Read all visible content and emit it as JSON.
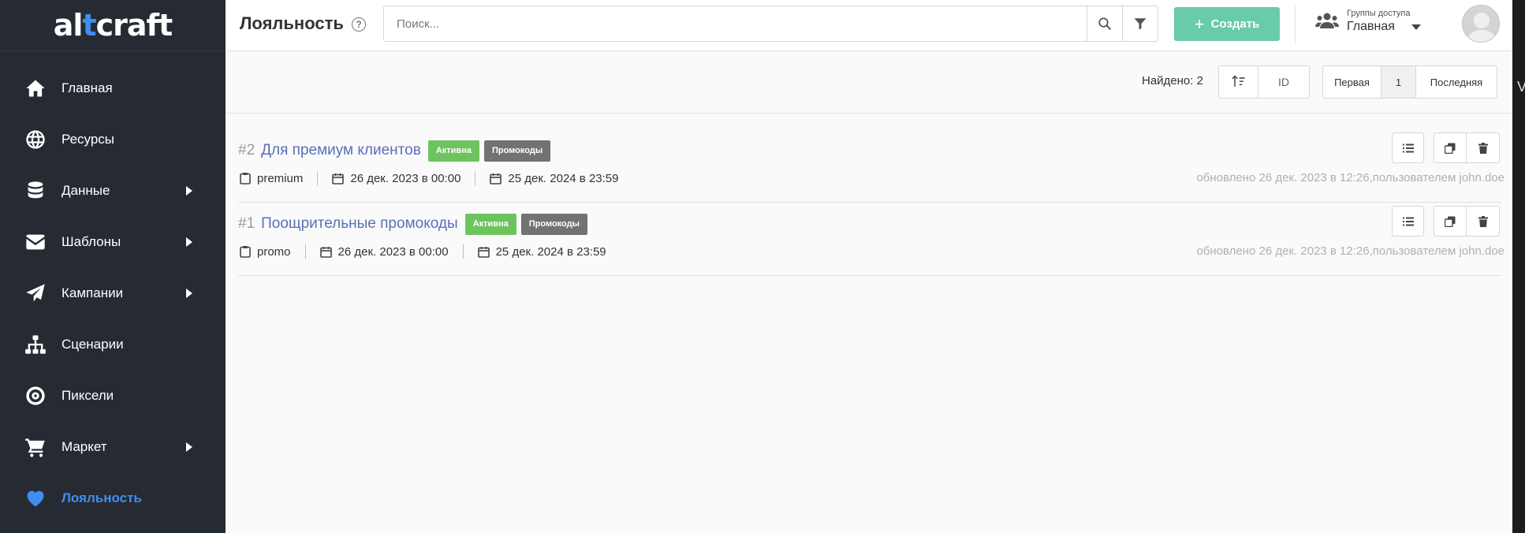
{
  "sidebar": {
    "logo": {
      "part1": "al",
      "part2": "t",
      "part3": "craft"
    },
    "items": [
      {
        "label": "Главная",
        "icon": "home-icon",
        "has_submenu": false
      },
      {
        "label": "Ресурсы",
        "icon": "globe-icon",
        "has_submenu": false
      },
      {
        "label": "Данные",
        "icon": "database-icon",
        "has_submenu": true
      },
      {
        "label": "Шаблоны",
        "icon": "envelope-icon",
        "has_submenu": true
      },
      {
        "label": "Кампании",
        "icon": "paper-plane-icon",
        "has_submenu": true
      },
      {
        "label": "Сценарии",
        "icon": "sitemap-icon",
        "has_submenu": false
      },
      {
        "label": "Пиксели",
        "icon": "target-icon",
        "has_submenu": false
      },
      {
        "label": "Маркет",
        "icon": "cart-icon",
        "has_submenu": true
      },
      {
        "label": "Лояльность",
        "icon": "heart-icon",
        "has_submenu": false,
        "active": true
      }
    ]
  },
  "header": {
    "title": "Лояльность",
    "help": "?",
    "search_placeholder": "Поиск...",
    "create_label": "Создать",
    "access_label": "Группы доступа",
    "access_value": "Главная"
  },
  "toolbar": {
    "found": "Найдено: 2",
    "sort_field": "ID",
    "pager": {
      "first": "Первая",
      "current": "1",
      "last": "Последняя"
    }
  },
  "rows": [
    {
      "id": "#2",
      "name": "Для премиум клиентов",
      "status": "Активна",
      "type": "Промокоды",
      "code": "premium",
      "start": "26 дек. 2023 в 00:00",
      "end": "25 дек. 2024 в 23:59",
      "updated": "обновлено 26 дек. 2023 в 12:26,пользователем john.doe"
    },
    {
      "id": "#1",
      "name": "Поощрительные промокоды",
      "status": "Активна",
      "type": "Промокоды",
      "code": "promo",
      "start": "26 дек. 2023 в 00:00",
      "end": "25 дек. 2024 в 23:59",
      "updated": "обновлено 26 дек. 2023 в 12:26,пользователем john.doe"
    }
  ],
  "edge_char": "V",
  "colors": {
    "sidebar_bg": "#262b33",
    "accent": "#3f8ef0",
    "create_btn": "#68cbaa",
    "status_active": "#6dc45f",
    "type_badge": "#727272",
    "link": "#5b6fb8"
  }
}
